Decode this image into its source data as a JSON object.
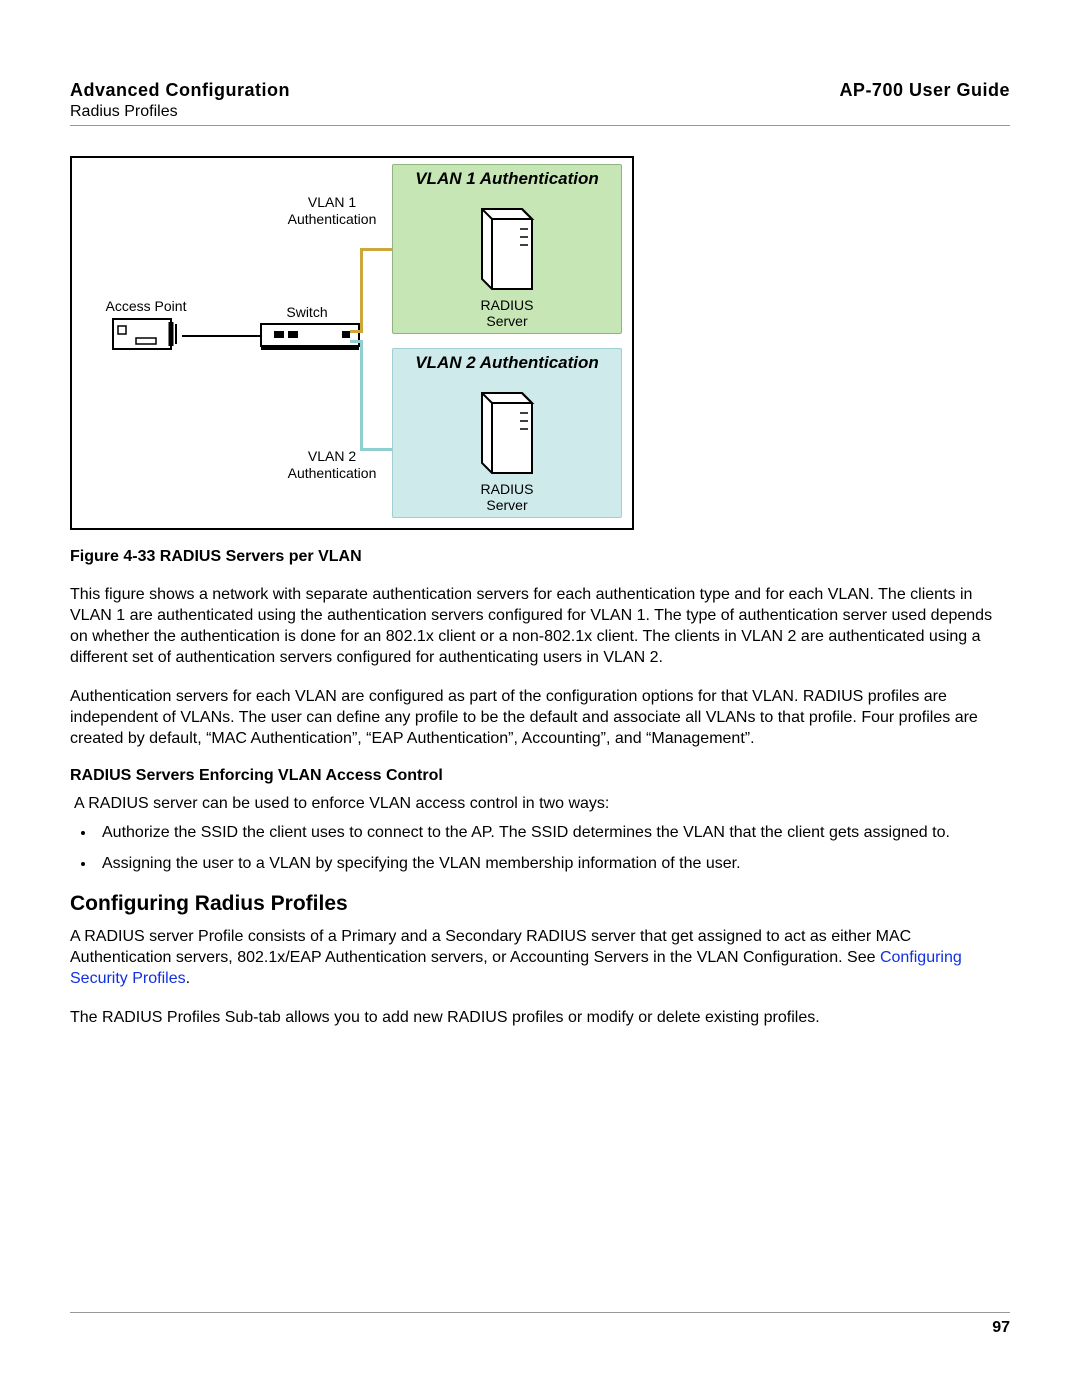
{
  "header": {
    "chapter": "Advanced Configuration",
    "section": "Radius Profiles",
    "doc_title": "AP-700 User Guide"
  },
  "figure": {
    "vlan1_title": "VLAN 1 Authentication",
    "vlan2_title": "VLAN 2 Authentication",
    "radius_label1": "RADIUS",
    "radius_label2": "Server",
    "ap_label": "Access Point",
    "switch_label": "Switch",
    "vlan1_link_line1": "VLAN 1",
    "vlan1_link_line2": "Authentication",
    "vlan2_link_line1": "VLAN 2",
    "vlan2_link_line2": "Authentication",
    "caption": "Figure 4-33 RADIUS Servers per VLAN"
  },
  "para1": "This figure shows a network with separate authentication servers for each authentication type and for each VLAN. The clients in VLAN 1 are authenticated using the authentication servers configured for VLAN 1. The type of authentication server used depends on whether the authentication is done for an 802.1x client or a non-802.1x client. The clients in VLAN 2 are authenticated using a different set of authentication servers configured for authenticating users in VLAN 2.",
  "para2": "Authentication servers for each VLAN are configured as part of the configuration options for that VLAN. RADIUS profiles are independent of VLANs. The user can define any profile to be the default and associate all VLANs to that profile. Four profiles are created by default, “MAC Authentication”, “EAP Authentication”, Accounting”, and “Management”.",
  "access_control": {
    "heading": "RADIUS Servers Enforcing VLAN Access Control",
    "intro": "A RADIUS server can be used to enforce VLAN access control in two ways:",
    "bullets": [
      "Authorize the SSID the client uses to connect to the AP. The SSID determines the VLAN that the client gets assigned to.",
      "Assigning the user to a VLAN by specifying the VLAN membership information of the user."
    ]
  },
  "configuring": {
    "heading": "Configuring Radius Profiles",
    "para_pre_link": "A RADIUS server Profile consists of a Primary and a Secondary RADIUS server that get assigned to act as either MAC Authentication servers, 802.1x/EAP Authentication servers, or Accounting Servers in the VLAN Configuration. See ",
    "link_text": "Configuring Security Profiles",
    "para_post_link": ".",
    "para2": "The RADIUS Profiles Sub-tab allows you to add new RADIUS profiles or modify or delete existing profiles."
  },
  "page_number": "97"
}
